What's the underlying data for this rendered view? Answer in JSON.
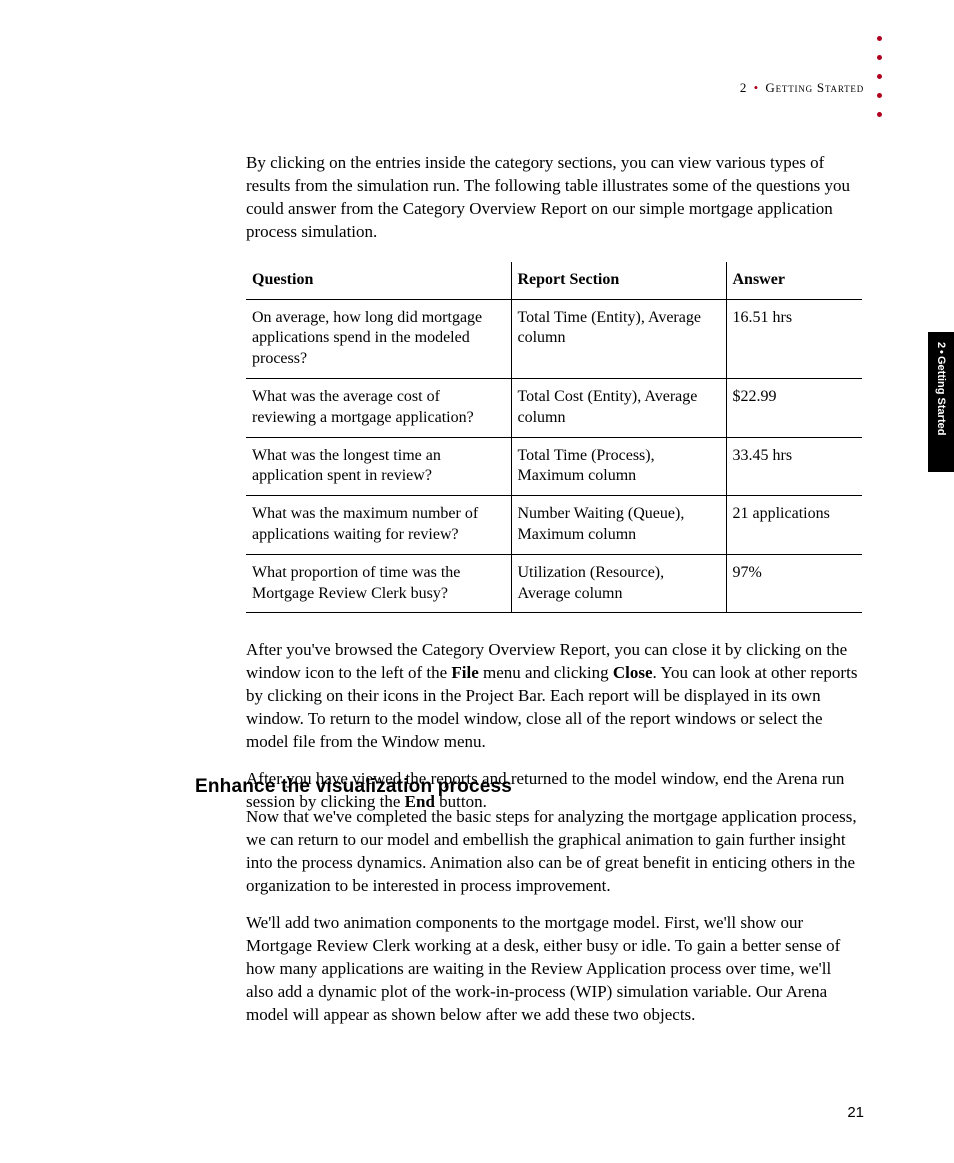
{
  "header": {
    "chapter_number": "2",
    "bullet": "•",
    "chapter_title": "Getting Started"
  },
  "sidetab": {
    "chapter_number": "2",
    "bullet": "•",
    "chapter_title": "Getting Started"
  },
  "intro_para": "By clicking on the entries inside the category sections, you can view various types of results from the simulation run. The following table illustrates some of the questions you could answer from the Category Overview Report on our simple mortgage application process simulation.",
  "table": {
    "headers": {
      "q": "Question",
      "r": "Report Section",
      "a": "Answer"
    },
    "rows": [
      {
        "q": "On average, how long did mortgage applications spend in the modeled process?",
        "r": "Total Time (Entity), Average column",
        "a": "16.51 hrs"
      },
      {
        "q": "What was the average cost of reviewing a mortgage application?",
        "r": "Total Cost (Entity), Average column",
        "a": "$22.99"
      },
      {
        "q": "What was the longest time an application spent in review?",
        "r": "Total Time (Process), Maximum column",
        "a": "33.45 hrs"
      },
      {
        "q": "What was the maximum number of applications waiting for review?",
        "r": "Number Waiting (Queue), Maximum column",
        "a": "21 applications"
      },
      {
        "q": "What proportion of time was the Mortgage Review Clerk busy?",
        "r": "Utilization (Resource), Average column",
        "a": "97%"
      }
    ]
  },
  "para2": {
    "pre": "After you've browsed the Category Overview Report, you can close it by clicking on the window icon to the left of the ",
    "bold1": "File",
    "mid1": " menu and clicking ",
    "bold2": "Close",
    "post": ". You can look at other reports by clicking on their icons in the Project Bar. Each report will be displayed in its own window. To return to the model window, close all of the report windows or select the model file from the Window menu."
  },
  "para3": {
    "pre": "After you have viewed the reports and returned to the model window, end the Arena run session by clicking the ",
    "bold": "End",
    "post": " button."
  },
  "section_heading": "Enhance the visualization process",
  "para4": "Now that we've completed the basic steps for analyzing the mortgage application process, we can return to our model and embellish the graphical animation to gain further insight into the process dynamics. Animation also can be of great benefit in enticing others in the organization to be interested in process improvement.",
  "para5": "We'll add two animation components to the mortgage model. First, we'll show our Mortgage Review Clerk working at a desk, either busy or idle. To gain a better sense of how many applications are waiting in the Review Application process over time, we'll also add a dynamic plot of the work-in-process (WIP) simulation variable. Our Arena model will appear as shown below after we add these two objects.",
  "page_number": "21"
}
